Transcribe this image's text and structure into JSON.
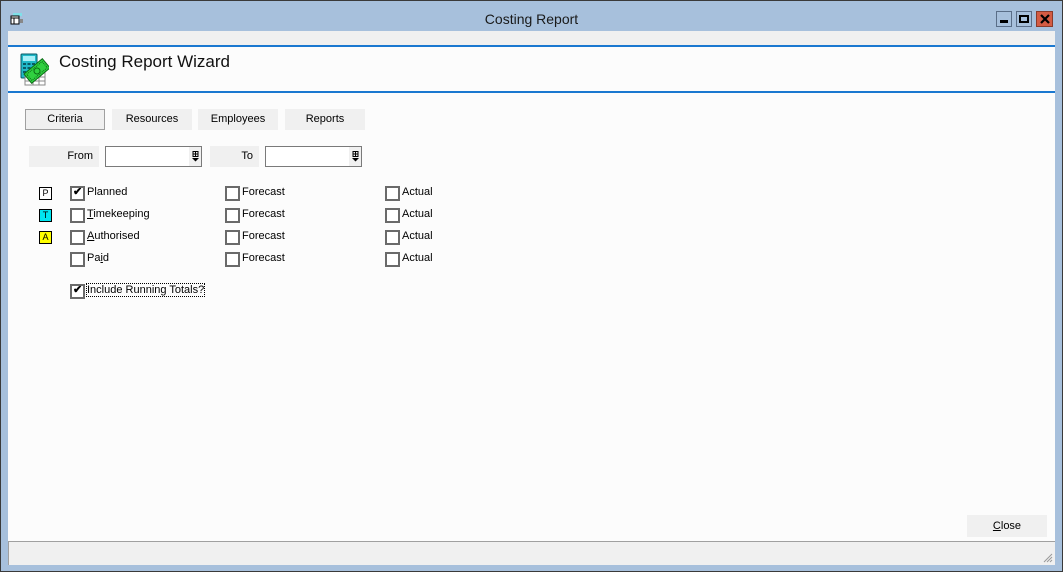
{
  "window": {
    "title": "Costing Report",
    "controls": {
      "minimize": "minimize",
      "maximize": "maximize",
      "close": "close"
    }
  },
  "header": {
    "title": "Costing Report Wizard",
    "icon": "calculator-money-icon"
  },
  "tabs": [
    {
      "label": "Criteria",
      "active": true
    },
    {
      "label": "Resources",
      "active": false
    },
    {
      "label": "Employees",
      "active": false
    },
    {
      "label": "Reports",
      "active": false
    }
  ],
  "date_range": {
    "from_label": "From",
    "from_value": "",
    "to_label": "To",
    "to_value": ""
  },
  "rows": [
    {
      "badge": "P",
      "badge_color": "#ffffff",
      "label": "Planned",
      "mnemonic": "",
      "checked": true,
      "forecast_label": "Forecast",
      "forecast_checked": false,
      "actual_label": "Actual",
      "actual_checked": false
    },
    {
      "badge": "T",
      "badge_color": "#00e5f0",
      "label": "Timekeeping",
      "mnemonic": "T",
      "checked": false,
      "forecast_label": "Forecast",
      "forecast_checked": false,
      "actual_label": "Actual",
      "actual_checked": false
    },
    {
      "badge": "A",
      "badge_color": "#ffff00",
      "label": "Authorised",
      "mnemonic": "A",
      "checked": false,
      "forecast_label": "Forecast",
      "forecast_checked": false,
      "actual_label": "Actual",
      "actual_checked": false
    },
    {
      "badge": "",
      "badge_color": "",
      "label": "Paid",
      "mnemonic": "i",
      "checked": false,
      "forecast_label": "Forecast",
      "forecast_checked": false,
      "actual_label": "Actual",
      "actual_checked": false
    }
  ],
  "running_totals": {
    "label": "Include Running Totals?",
    "checked": true
  },
  "footer": {
    "close_label": "Close"
  },
  "colors": {
    "titlebar": "#a7c0dc",
    "accent_line": "#1a78d0",
    "close_button": "#d45b43"
  }
}
